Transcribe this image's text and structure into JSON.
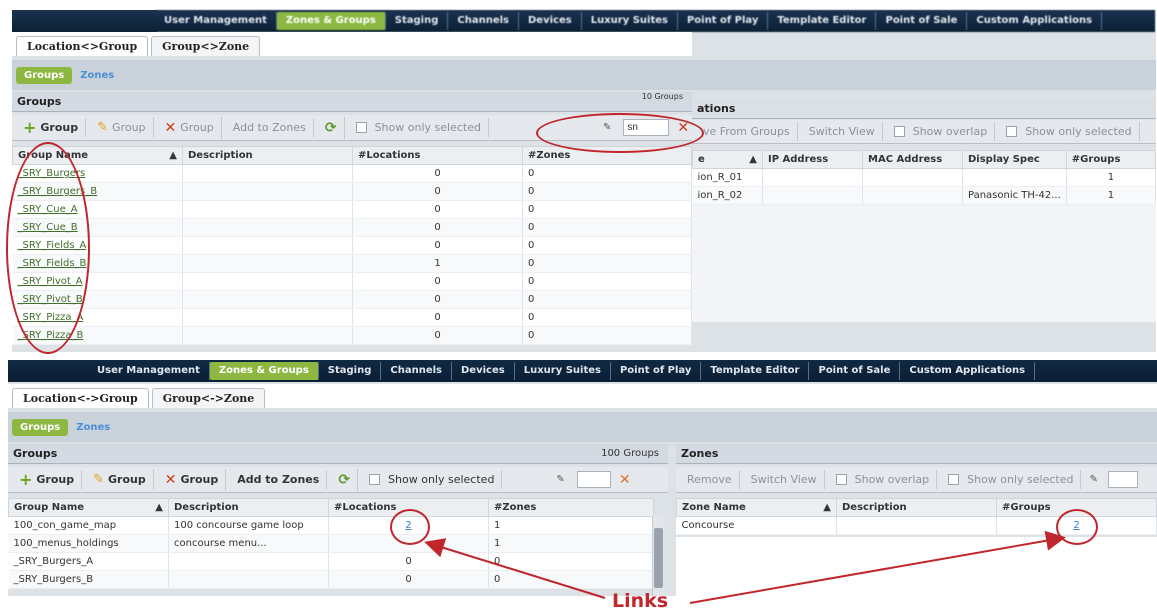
{
  "top": {
    "nav": [
      "User Management",
      "Zones & Groups",
      "Staging",
      "Channels",
      "Devices",
      "Luxury Suites",
      "Point of Play",
      "Template Editor",
      "Point of Sale",
      "Custom Applications"
    ],
    "tabs": [
      "Location<>Group",
      "Group<>Zone"
    ],
    "subbar": {
      "groups": "Groups",
      "zones": "Zones"
    },
    "groups_panel": {
      "title": "Groups",
      "count": "10 Groups"
    },
    "toolbar": {
      "add": "Group",
      "edit": "Group",
      "delete": "Group",
      "add_to_zones": "Add to Zones",
      "show_only_selected": "Show only selected",
      "search_value": "sn"
    },
    "columns": [
      "Group Name",
      "Description",
      "#Locations",
      "#Zones"
    ],
    "rows": [
      {
        "name": "_SRY_Burgers",
        "desc": "",
        "locations": "0",
        "zones": "0"
      },
      {
        "name": "_SRY_Burgers_B",
        "desc": "",
        "locations": "0",
        "zones": "0"
      },
      {
        "name": "_SRY_Cue_A",
        "desc": "",
        "locations": "0",
        "zones": "0"
      },
      {
        "name": "_SRY_Cue_B",
        "desc": "",
        "locations": "0",
        "zones": "0"
      },
      {
        "name": "_SRY_Fields_A",
        "desc": "",
        "locations": "0",
        "zones": "0"
      },
      {
        "name": "_SRY_Fields_B",
        "desc": "",
        "locations": "1",
        "zones": "0"
      },
      {
        "name": "_SRY_Pivot_A",
        "desc": "",
        "locations": "0",
        "zones": "0"
      },
      {
        "name": "_SRY_Pivot_B",
        "desc": "",
        "locations": "0",
        "zones": "0"
      },
      {
        "name": "_SRY_Pizza_A",
        "desc": "",
        "locations": "0",
        "zones": "0"
      },
      {
        "name": "_SRY_Pizza_B",
        "desc": "",
        "locations": "0",
        "zones": "0"
      }
    ],
    "locations_panel": {
      "title": "ations",
      "remove": "ve From Groups",
      "switch_view": "Switch View",
      "show_overlap": "Show overlap",
      "show_only_selected": "Show only selected",
      "columns": [
        "e",
        "IP Address",
        "MAC Address",
        "Display Spec",
        "#Groups"
      ],
      "rows": [
        {
          "name": "ion_R_01",
          "ip": "",
          "mac": "",
          "spec": "",
          "groups": "1"
        },
        {
          "name": "ion_R_02",
          "ip": "",
          "mac": "",
          "spec": "Panasonic TH-42...",
          "groups": "1"
        }
      ]
    }
  },
  "bottom": {
    "nav": [
      "User Management",
      "Zones & Groups",
      "Staging",
      "Channels",
      "Devices",
      "Luxury Suites",
      "Point of Play",
      "Template Editor",
      "Point of Sale",
      "Custom Applications"
    ],
    "tabs": [
      "Location<->Group",
      "Group<->Zone"
    ],
    "subbar": {
      "groups": "Groups",
      "zones": "Zones"
    },
    "groups_panel": {
      "title": "Groups",
      "count": "100 Groups"
    },
    "toolbar": {
      "add": "Group",
      "edit": "Group",
      "delete": "Group",
      "add_to_zones": "Add to Zones",
      "show_only_selected": "Show only selected",
      "search_value": ""
    },
    "columns": [
      "Group Name",
      "Description",
      "#Locations",
      "#Zones"
    ],
    "rows": [
      {
        "name": "100_con_game_map",
        "desc": "100 concourse game loop",
        "locations": "2",
        "zones": "1"
      },
      {
        "name": "100_menus_holdings",
        "desc": "concourse menu...",
        "locations": "",
        "zones": "1"
      },
      {
        "name": "_SRY_Burgers_A",
        "desc": "",
        "locations": "0",
        "zones": "0"
      },
      {
        "name": "_SRY_Burgers_B",
        "desc": "",
        "locations": "0",
        "zones": "0"
      }
    ],
    "zones_panel": {
      "title": "Zones",
      "remove": "Remove",
      "switch_view": "Switch View",
      "show_overlap": "Show overlap",
      "show_only_selected": "Show only selected",
      "columns": [
        "Zone Name",
        "Description",
        "#Groups"
      ],
      "rows": [
        {
          "name": "Concourse",
          "desc": "",
          "groups": "2"
        }
      ]
    }
  },
  "annotation": {
    "label": "Links"
  },
  "colors": {
    "nav_bg": "#1a3350",
    "accent_green": "#8cb842",
    "annotation_red": "#c0262b",
    "link_blue": "#3d7fd0"
  }
}
